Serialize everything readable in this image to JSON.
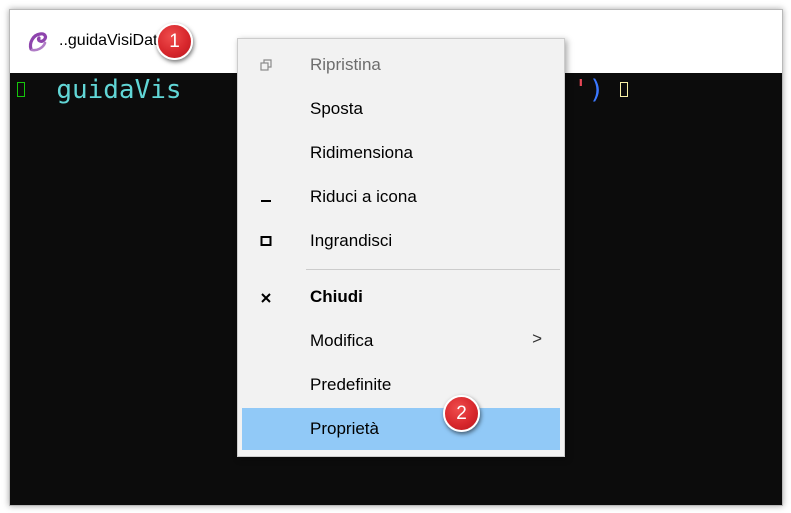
{
  "window": {
    "title": "..guidaVisiData"
  },
  "console": {
    "text": "guidaVis",
    "closing_paren": ")"
  },
  "context_menu": {
    "items": [
      {
        "label": "Ripristina",
        "icon": "restore-icon",
        "state": "disabled"
      },
      {
        "label": "Sposta"
      },
      {
        "label": "Ridimensiona"
      },
      {
        "label": "Riduci a icona",
        "icon": "minimize-icon"
      },
      {
        "label": "Ingrandisci",
        "icon": "maximize-icon"
      },
      {
        "label": "Chiudi",
        "icon": "close-icon",
        "bold": true
      },
      {
        "label": "Modifica",
        "submenu": true,
        "arrow": ">"
      },
      {
        "label": "Predefinite"
      },
      {
        "label": "Proprietà",
        "highlighted": true
      }
    ]
  },
  "callouts": [
    {
      "number": "1"
    },
    {
      "number": "2"
    }
  ],
  "colors": {
    "menu_background": "#f2f2f2",
    "highlight": "#91c9f7",
    "callout_red": "#d8282d",
    "console_background": "#0c0c0c",
    "console_cyan": "#61d6d6"
  }
}
